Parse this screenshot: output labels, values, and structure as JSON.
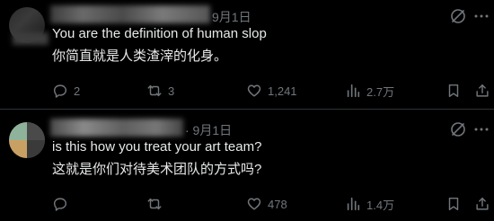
{
  "replies": [
    {
      "date": "9月1日",
      "text_en": "You are the definition of human slop",
      "text_zh": "你简直就是人类渣滓的化身。",
      "stats": {
        "replies": "2",
        "reposts": "3",
        "likes": "1,241",
        "views": "2.7万"
      }
    },
    {
      "date": "· 9月1日",
      "text_en": "is this how you treat your art team?",
      "text_zh": "这就是你们对待美术团队的方式吗?",
      "stats": {
        "replies": "",
        "reposts": "",
        "likes": "478",
        "views": "1.4万"
      }
    }
  ],
  "icons": {
    "grok": "grok-icon",
    "more": "more-icon",
    "reply": "reply-icon",
    "repost": "repost-icon",
    "like": "like-icon",
    "views": "views-icon",
    "bookmark": "bookmark-icon",
    "share": "share-icon"
  },
  "colors": {
    "background": "#000000",
    "text": "#e7e9ea",
    "muted": "#71767b",
    "divider": "#2f3336"
  }
}
